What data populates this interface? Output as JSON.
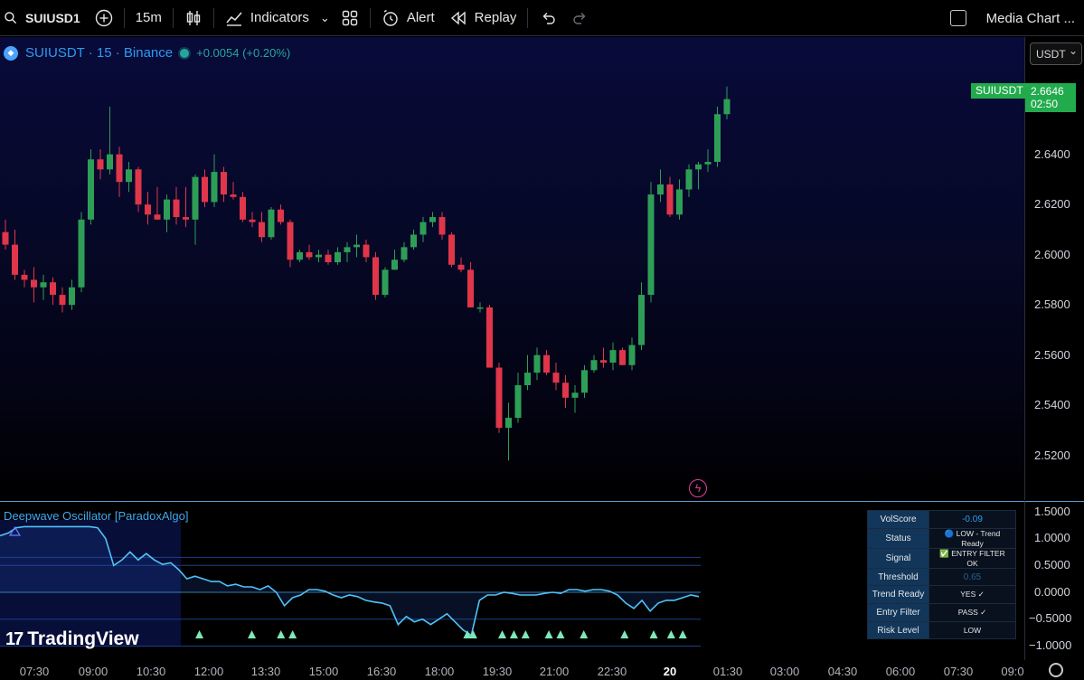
{
  "toolbar": {
    "symbol": "SUIUSD1",
    "interval": "15m",
    "indicators_label": "Indicators",
    "alert_label": "Alert",
    "replay_label": "Replay",
    "layout_name": "Media Chart ..."
  },
  "legend": {
    "symbol_label": "SUIUSDT · 15 · Binance",
    "change": "+0.0054 (+0.20%)"
  },
  "currency": "USDT",
  "last_price": {
    "symbol_tag": "SUIUSDT",
    "price": "2.6646",
    "countdown": "02:50"
  },
  "price_axis": {
    "ticks": [
      "2.6400",
      "2.6200",
      "2.6000",
      "2.5800",
      "2.5600",
      "2.5400",
      "2.5200"
    ]
  },
  "indicator": {
    "title": "Deepwave Oscillator [ParadoxAlgo]",
    "axis_ticks": [
      "1.5000",
      "1.0000",
      "0.5000",
      "0.0000",
      "−0.5000",
      "−1.0000"
    ],
    "table": [
      {
        "key": "VolScore",
        "value": "-0.09"
      },
      {
        "key": "Status",
        "value": "🔵 LOW - Trend Ready"
      },
      {
        "key": "Signal",
        "value": "✅ ENTRY FILTER OK"
      },
      {
        "key": "Threshold",
        "value": "0.65"
      },
      {
        "key": "Trend Ready",
        "value": "YES ✓"
      },
      {
        "key": "Entry Filter",
        "value": "PASS ✓"
      },
      {
        "key": "Risk Level",
        "value": "LOW"
      }
    ]
  },
  "watermark": "TradingView",
  "time_axis": {
    "labels": [
      "07:30",
      "09:00",
      "10:30",
      "12:00",
      "13:30",
      "15:00",
      "16:30",
      "18:00",
      "19:30",
      "21:00",
      "22:30",
      "20",
      "01:30",
      "03:00",
      "04:30",
      "06:00",
      "07:30",
      "09:0"
    ]
  },
  "colors": {
    "up": "#26a69a",
    "up_candle": "#2e9e57",
    "down_candle": "#e0364a",
    "accent": "#2d9bf0",
    "last_price_bg": "#22ab4d",
    "oscillator_line": "#4fc3f7",
    "signal_marker": "#7ee8b8"
  },
  "icons": [
    "search-icon",
    "add-symbol-icon",
    "candles-icon",
    "indicators-icon",
    "chevron-down-icon",
    "templates-icon",
    "alert-icon",
    "replay-icon",
    "undo-icon",
    "redo-icon",
    "checkbox-icon",
    "coin-icon",
    "lightning-icon",
    "gear-icon"
  ],
  "chart_data": {
    "type": "candlestick",
    "series": [
      {
        "name": "SUIUSDT",
        "ohlc": [
          [
            2.612,
            2.617,
            2.605,
            2.607
          ],
          [
            2.607,
            2.613,
            2.593,
            2.595
          ],
          [
            2.595,
            2.597,
            2.59,
            2.593
          ],
          [
            2.593,
            2.598,
            2.584,
            2.59
          ],
          [
            2.59,
            2.595,
            2.585,
            2.592
          ],
          [
            2.592,
            2.594,
            2.583,
            2.587
          ],
          [
            2.587,
            2.59,
            2.58,
            2.583
          ],
          [
            2.583,
            2.593,
            2.581,
            2.59
          ],
          [
            2.59,
            2.62,
            2.588,
            2.617
          ],
          [
            2.617,
            2.645,
            2.615,
            2.641
          ],
          [
            2.641,
            2.645,
            2.633,
            2.637
          ],
          [
            2.637,
            2.662,
            2.635,
            2.643
          ],
          [
            2.643,
            2.646,
            2.626,
            2.632
          ],
          [
            2.632,
            2.64,
            2.628,
            2.637
          ],
          [
            2.637,
            2.638,
            2.62,
            2.623
          ],
          [
            2.623,
            2.628,
            2.615,
            2.619
          ],
          [
            2.619,
            2.63,
            2.617,
            2.617
          ],
          [
            2.617,
            2.627,
            2.612,
            2.625
          ],
          [
            2.625,
            2.63,
            2.615,
            2.618
          ],
          [
            2.618,
            2.63,
            2.614,
            2.617
          ],
          [
            2.617,
            2.635,
            2.607,
            2.634
          ],
          [
            2.634,
            2.637,
            2.622,
            2.624
          ],
          [
            2.624,
            2.643,
            2.622,
            2.636
          ],
          [
            2.636,
            2.638,
            2.624,
            2.627
          ],
          [
            2.627,
            2.632,
            2.625,
            2.626
          ],
          [
            2.626,
            2.628,
            2.616,
            2.617
          ],
          [
            2.617,
            2.62,
            2.614,
            2.616
          ],
          [
            2.616,
            2.62,
            2.608,
            2.61
          ],
          [
            2.61,
            2.622,
            2.609,
            2.621
          ],
          [
            2.621,
            2.623,
            2.615,
            2.616
          ],
          [
            2.616,
            2.617,
            2.598,
            2.601
          ],
          [
            2.601,
            2.605,
            2.6,
            2.604
          ],
          [
            2.604,
            2.607,
            2.601,
            2.602
          ],
          [
            2.602,
            2.605,
            2.6,
            2.603
          ],
          [
            2.603,
            2.605,
            2.599,
            2.6
          ],
          [
            2.6,
            2.606,
            2.599,
            2.604
          ],
          [
            2.604,
            2.608,
            2.6,
            2.606
          ],
          [
            2.606,
            2.611,
            2.602,
            2.607
          ],
          [
            2.607,
            2.609,
            2.6,
            2.602
          ],
          [
            2.602,
            2.604,
            2.585,
            2.587
          ],
          [
            2.587,
            2.598,
            2.586,
            2.597
          ],
          [
            2.597,
            2.605,
            2.597,
            2.601
          ],
          [
            2.601,
            2.608,
            2.6,
            2.606
          ],
          [
            2.606,
            2.613,
            2.605,
            2.611
          ],
          [
            2.611,
            2.618,
            2.608,
            2.616
          ],
          [
            2.616,
            2.62,
            2.614,
            2.618
          ],
          [
            2.618,
            2.62,
            2.609,
            2.611
          ],
          [
            2.611,
            2.612,
            2.598,
            2.599
          ],
          [
            2.599,
            2.602,
            2.596,
            2.597
          ],
          [
            2.597,
            2.6,
            2.582,
            2.582
          ],
          [
            2.582,
            2.584,
            2.58,
            2.582
          ],
          [
            2.582,
            2.583,
            2.559,
            2.558
          ],
          [
            2.558,
            2.56,
            2.532,
            2.534
          ],
          [
            2.534,
            2.544,
            2.521,
            2.538
          ],
          [
            2.538,
            2.556,
            2.536,
            2.551
          ],
          [
            2.551,
            2.563,
            2.549,
            2.556
          ],
          [
            2.556,
            2.566,
            2.553,
            2.563
          ],
          [
            2.563,
            2.565,
            2.555,
            2.556
          ],
          [
            2.556,
            2.56,
            2.549,
            2.552
          ],
          [
            2.552,
            2.555,
            2.542,
            2.546
          ],
          [
            2.546,
            2.551,
            2.54,
            2.548
          ],
          [
            2.548,
            2.559,
            2.546,
            2.557
          ],
          [
            2.557,
            2.563,
            2.556,
            2.561
          ],
          [
            2.561,
            2.566,
            2.558,
            2.56
          ],
          [
            2.56,
            2.568,
            2.557,
            2.565
          ],
          [
            2.565,
            2.566,
            2.559,
            2.559
          ],
          [
            2.559,
            2.57,
            2.557,
            2.567
          ],
          [
            2.567,
            2.592,
            2.565,
            2.587
          ],
          [
            2.587,
            2.632,
            2.584,
            2.627
          ],
          [
            2.627,
            2.637,
            2.624,
            2.631
          ],
          [
            2.631,
            2.634,
            2.618,
            2.619
          ],
          [
            2.619,
            2.633,
            2.617,
            2.629
          ],
          [
            2.629,
            2.639,
            2.626,
            2.637
          ],
          [
            2.637,
            2.64,
            2.629,
            2.639
          ],
          [
            2.639,
            2.645,
            2.636,
            2.64
          ],
          [
            2.64,
            2.662,
            2.638,
            2.659
          ],
          [
            2.659,
            2.67,
            2.657,
            2.665
          ]
        ]
      }
    ],
    "price_ticks": [
      2.64,
      2.62,
      2.6,
      2.58,
      2.56,
      2.54,
      2.52
    ],
    "last_price": 2.6646,
    "oscillator": {
      "name": "Deepwave Oscillator [ParadoxAlgo]",
      "values": [
        1.05,
        1.1,
        1.2,
        1.22,
        1.22,
        1.22,
        1.22,
        1.22,
        1.22,
        1.22,
        1.22,
        1.22,
        1.2,
        1.0,
        0.5,
        0.6,
        0.75,
        0.6,
        0.72,
        0.6,
        0.52,
        0.55,
        0.42,
        0.25,
        0.3,
        0.25,
        0.2,
        0.2,
        0.12,
        0.15,
        0.1,
        0.1,
        0.05,
        0.12,
        0.0,
        -0.25,
        -0.1,
        -0.05,
        0.05,
        0.05,
        0.02,
        -0.05,
        -0.1,
        -0.05,
        -0.08,
        -0.15,
        -0.18,
        -0.2,
        -0.25,
        -0.6,
        -0.45,
        -0.55,
        -0.5,
        -0.6,
        -0.5,
        -0.4,
        -0.55,
        -0.7,
        -0.8,
        -0.15,
        -0.05,
        -0.05,
        0.0,
        -0.02,
        -0.05,
        -0.05,
        -0.05,
        -0.02,
        0.0,
        -0.02,
        0.05,
        0.05,
        0.02,
        0.05,
        0.05,
        0.02,
        -0.05,
        -0.2,
        -0.3,
        -0.15,
        -0.35,
        -0.2,
        -0.15,
        -0.15,
        -0.1,
        -0.05,
        -0.08
      ],
      "signal_marker_indices": [
        33,
        42,
        47,
        49,
        79,
        80,
        85,
        87,
        89,
        93,
        95,
        99,
        106,
        111,
        114,
        116
      ]
    }
  }
}
